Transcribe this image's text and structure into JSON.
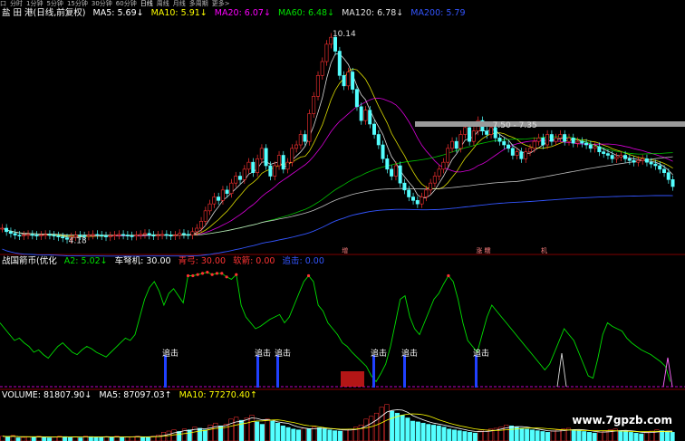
{
  "toolbar": {
    "items": [
      "口",
      "分时",
      "1分钟",
      "5分钟",
      "15分钟",
      "30分钟",
      "60分钟",
      "日线",
      "周线",
      "月线",
      "多周期",
      "更多>"
    ],
    "active_index": 7
  },
  "main_legend": {
    "stock": "盐 田 港(日线,前复权)",
    "ma5": "MA5: 5.69↓",
    "ma10": "MA10: 5.91↓",
    "ma20": "MA20: 6.07↓",
    "ma60": "MA60: 6.48↓",
    "ma120": "MA120: 6.78↓",
    "ma200": "MA200: 5.79",
    "colors": {
      "ma5": "#ffffff",
      "ma10": "#ffff00",
      "ma20": "#ff00ff",
      "ma60": "#00e000",
      "ma120": "#e0e0e0",
      "ma200": "#3355ff"
    }
  },
  "indicator_legend": {
    "name": "战国箭币(优化",
    "a2": "A2: 5.02↓",
    "cheng": "车弩机: 30.00",
    "qingong": "青弓: 30.00",
    "ruanjian": "软箭: 0.00",
    "zhuiji": "追击: 0.00",
    "colors": {
      "a2": "#00e000",
      "cheng": "#ffffff",
      "qingong": "#ff3333",
      "ruanjian": "#ff3333",
      "zhuiji": "#3355ff"
    }
  },
  "volume_legend": {
    "volume": "VOLUME: 81807.90↓",
    "ma5": "MA5: 87097.03↑",
    "ma10": "MA10: 77270.40↑"
  },
  "watermark": "www.7gpzb.com",
  "chart_data": [
    {
      "type": "candlestick",
      "annotations": [
        {
          "text": "10.14",
          "x_index": 76,
          "y": 10.14
        },
        {
          "text": "4.18",
          "x_index": 15,
          "y": 4.18
        },
        {
          "text": "7.50 - 7.35",
          "x_index": 113,
          "y": 7.5
        }
      ],
      "markers": [
        {
          "text": "增",
          "x_index": 79
        },
        {
          "text": "涨 糯",
          "x_index": 110
        },
        {
          "text": "机",
          "x_index": 125
        }
      ],
      "ylim": [
        3.9,
        10.5
      ],
      "close": [
        4.5,
        4.4,
        4.35,
        4.3,
        4.28,
        4.3,
        4.32,
        4.3,
        4.28,
        4.3,
        4.32,
        4.3,
        4.28,
        4.25,
        4.22,
        4.18,
        4.25,
        4.3,
        4.28,
        4.27,
        4.3,
        4.32,
        4.3,
        4.28,
        4.25,
        4.28,
        4.3,
        4.32,
        4.3,
        4.28,
        4.27,
        4.3,
        4.32,
        4.35,
        4.3,
        4.28,
        4.3,
        4.32,
        4.3,
        4.28,
        4.3,
        4.35,
        4.32,
        4.3,
        4.4,
        4.5,
        4.7,
        5.0,
        5.2,
        5.4,
        5.3,
        5.6,
        5.5,
        5.8,
        6.0,
        5.9,
        6.2,
        6.4,
        6.1,
        6.5,
        6.8,
        6.3,
        6.0,
        6.3,
        6.6,
        6.2,
        6.4,
        6.8,
        6.9,
        7.2,
        7.0,
        7.8,
        8.3,
        8.9,
        9.3,
        9.8,
        10.0,
        9.6,
        8.9,
        8.6,
        9.0,
        8.5,
        8.0,
        7.6,
        7.9,
        7.5,
        7.2,
        6.9,
        6.5,
        6.2,
        6.0,
        6.3,
        5.8,
        5.6,
        5.4,
        5.3,
        5.2,
        5.4,
        5.6,
        5.8,
        6.0,
        6.2,
        6.4,
        6.8,
        7.0,
        6.8,
        7.2,
        7.4,
        7.0,
        7.3,
        7.6,
        7.3,
        7.2,
        7.4,
        7.1,
        7.0,
        6.9,
        6.8,
        6.6,
        6.7,
        6.5,
        6.7,
        6.8,
        7.0,
        7.1,
        6.9,
        7.2,
        7.0,
        7.1,
        7.2,
        7.0,
        7.1,
        6.95,
        7.0,
        6.95,
        6.9,
        6.8,
        6.85,
        6.7,
        6.65,
        6.6,
        6.5,
        6.55,
        6.6,
        6.5,
        6.45,
        6.4,
        6.45,
        6.5,
        6.4,
        6.35,
        6.3,
        6.2,
        6.1,
        5.9,
        5.7
      ]
    },
    {
      "type": "line",
      "name": "A2",
      "ylim": [
        0,
        100
      ],
      "values": [
        55,
        50,
        45,
        40,
        42,
        38,
        35,
        30,
        32,
        28,
        25,
        30,
        35,
        38,
        34,
        30,
        28,
        32,
        35,
        33,
        30,
        28,
        26,
        30,
        34,
        38,
        42,
        40,
        45,
        60,
        75,
        85,
        90,
        82,
        70,
        80,
        84,
        78,
        72,
        95,
        95,
        96,
        97,
        98,
        96,
        97,
        97,
        94,
        92,
        96,
        70,
        60,
        55,
        50,
        52,
        55,
        58,
        60,
        62,
        55,
        60,
        70,
        80,
        90,
        95,
        90,
        70,
        65,
        55,
        50,
        45,
        38,
        35,
        30,
        26,
        22,
        18,
        10,
        5,
        12,
        20,
        35,
        55,
        75,
        78,
        60,
        50,
        45,
        55,
        65,
        75,
        80,
        88,
        95,
        90,
        75,
        55,
        40,
        35,
        30,
        45,
        60,
        70,
        65,
        60,
        55,
        50,
        45,
        40,
        35,
        30,
        25,
        20,
        15,
        20,
        30,
        40,
        50,
        45,
        40,
        30,
        20,
        10,
        8,
        25,
        45,
        55,
        52,
        50,
        48,
        42,
        38,
        35,
        32,
        30,
        28,
        25,
        22,
        18,
        5
      ]
    },
    {
      "type": "bar",
      "name": "VOLUME",
      "ylim": [
        0,
        100
      ],
      "values": [
        12,
        10,
        14,
        8,
        9,
        11,
        10,
        12,
        9,
        8,
        10,
        12,
        11,
        9,
        10,
        8,
        12,
        11,
        10,
        9,
        11,
        10,
        12,
        9,
        10,
        11,
        12,
        10,
        9,
        12,
        15,
        22,
        25,
        28,
        24,
        30,
        28,
        35,
        32,
        28,
        40,
        45,
        38,
        42,
        55,
        60,
        52,
        58,
        65,
        48,
        42,
        55,
        50,
        45,
        38,
        34,
        30,
        28,
        32,
        30,
        35,
        33,
        30,
        28,
        26,
        25,
        28,
        30,
        35,
        40,
        55,
        62,
        70,
        85,
        92,
        75,
        70,
        65,
        58,
        50,
        48,
        45,
        42,
        40,
        38,
        35,
        30,
        28,
        26,
        24,
        22,
        20,
        25,
        28,
        30,
        32,
        35,
        40,
        38,
        35,
        32,
        30,
        28,
        26,
        24,
        22,
        25,
        28,
        30,
        32,
        28,
        26,
        24,
        22,
        20,
        22,
        25,
        28,
        30,
        26,
        24,
        22,
        20,
        18,
        22,
        25,
        28,
        26,
        24,
        22
      ]
    }
  ]
}
